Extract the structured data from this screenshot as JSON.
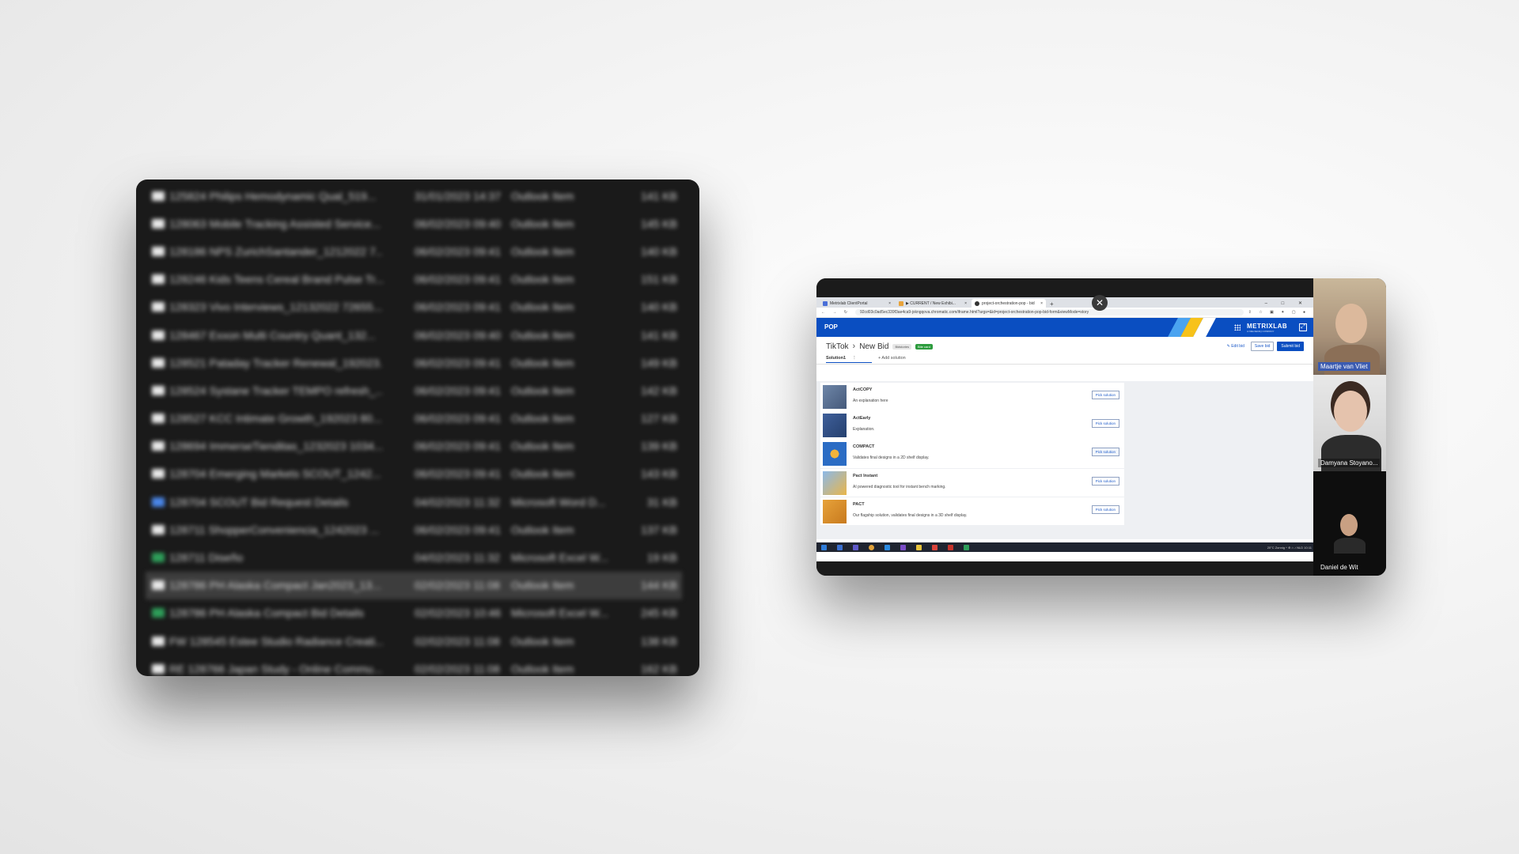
{
  "file_explorer": {
    "rows": [
      {
        "name": "125824 Philips Hemodynamic Qual_519...",
        "date": "31/01/2023 14:37",
        "type": "Outlook Item",
        "size": "141 KB",
        "icon": "mail-icon"
      },
      {
        "name": "128063 Mobile Tracking Assisted Service...",
        "date": "06/02/2023 09:40",
        "type": "Outlook Item",
        "size": "145 KB",
        "icon": "mail-icon"
      },
      {
        "name": "128186 NPS ZurichSantander_1212022 7...",
        "date": "06/02/2023 09:41",
        "type": "Outlook Item",
        "size": "140 KB",
        "icon": "mail-icon"
      },
      {
        "name": "128246 Kids Teens Cereal Brand Pulse Tr...",
        "date": "06/02/2023 09:41",
        "type": "Outlook Item",
        "size": "151 KB",
        "icon": "mail-icon"
      },
      {
        "name": "128323 Vivo Interviews_12132022 72655...",
        "date": "06/02/2023 09:41",
        "type": "Outlook Item",
        "size": "140 KB",
        "icon": "mail-icon"
      },
      {
        "name": "128467 Exxon Multi Country Quant_132...",
        "date": "06/02/2023 09:40",
        "type": "Outlook Item",
        "size": "141 KB",
        "icon": "mail-icon"
      },
      {
        "name": "128521 Pataday Tracker Renewal_192023...",
        "date": "06/02/2023 09:41",
        "type": "Outlook Item",
        "size": "149 KB",
        "icon": "mail-icon"
      },
      {
        "name": "128524 Systane Tracker TEMPO refresh_...",
        "date": "06/02/2023 09:41",
        "type": "Outlook Item",
        "size": "142 KB",
        "icon": "mail-icon"
      },
      {
        "name": "128527 KCC Intimate Growth_192023 80...",
        "date": "06/02/2023 09:41",
        "type": "Outlook Item",
        "size": "127 KB",
        "icon": "mail-icon"
      },
      {
        "name": "128694 ImmerseTienditas_1232023 1034...",
        "date": "06/02/2023 09:41",
        "type": "Outlook Item",
        "size": "139 KB",
        "icon": "mail-icon"
      },
      {
        "name": "128704 Emerging Markets SCOUT_1242...",
        "date": "06/02/2023 09:41",
        "type": "Outlook Item",
        "size": "143 KB",
        "icon": "mail-icon"
      },
      {
        "name": "128704 SCOUT Bid Request Details",
        "date": "04/02/2023 11:32",
        "type": "Microsoft Word D...",
        "size": "31 KB",
        "icon": "word-icon"
      },
      {
        "name": "128711 ShopperConveniencia_1242023 ...",
        "date": "06/02/2023 09:41",
        "type": "Outlook Item",
        "size": "137 KB",
        "icon": "mail-icon"
      },
      {
        "name": "128711 Diseño",
        "date": "04/02/2023 11:32",
        "type": "Microsoft Excel W...",
        "size": "19 KB",
        "icon": "excel-icon"
      },
      {
        "name": "128786 PH Alaska Compact Jan2023_13...",
        "date": "02/02/2023 11:08",
        "type": "Outlook Item",
        "size": "144 KB",
        "icon": "mail-icon",
        "selected": true
      },
      {
        "name": "128786 PH Alaska Compact Bid Details",
        "date": "02/02/2023 10:46",
        "type": "Microsoft Excel W...",
        "size": "245 KB",
        "icon": "excel-icon"
      },
      {
        "name": "FW 128545 Estee Studio Radiance Creati...",
        "date": "02/02/2023 11:08",
        "type": "Outlook Item",
        "size": "138 KB",
        "icon": "mail-icon"
      },
      {
        "name": "RE 128766 Japan Study - Online Commu...",
        "date": "02/02/2023 11:08",
        "type": "Outlook Item",
        "size": "162 KB",
        "icon": "mail-icon"
      }
    ]
  },
  "browser": {
    "tabs": [
      {
        "title": "Metrixlab ClientPortal",
        "active": false
      },
      {
        "title": "▶ CURRENT / New Exhibi... ",
        "active": false
      },
      {
        "title": "project-orchestration-pop - bid",
        "active": true
      }
    ],
    "url": "92cd03c0ad5ec339f3ae4ca9-jxkngqova.chromatic.com/iframe.html?args=&id=project-orchestration-pop-bid-form&viewMode=story"
  },
  "app": {
    "brand": "POP",
    "logo": "METRIXLAB",
    "logo_tagline": "A NIELSENIQ COMPANY",
    "breadcrumb_client": "TikTok",
    "breadcrumb_page": "New Bid",
    "status_badge": "Bidstories",
    "green_badge": "Bite card",
    "edit_bid": "Edit bid",
    "save_bid": "Save bid",
    "submit_bid": "Submit bid",
    "tab_solution": "Solution1",
    "tab_more": "⋮",
    "add_solution": "+ Add solution",
    "solutions": [
      {
        "name": "ActCOPY",
        "description": "An explanation here",
        "button": "Pick solution"
      },
      {
        "name": "ActEarly",
        "description": "Explanation.",
        "button": "Pick solution"
      },
      {
        "name": "COMPACT",
        "description": "Validates final designs in a 2D shelf display.",
        "button": "Pick solution"
      },
      {
        "name": "Pact Instant",
        "description": "AI powered diagnostic tool for instant bench marking.",
        "button": "Pick solution"
      },
      {
        "name": "PACT",
        "description": "Our flagship solution, validates final designs in a 3D shelf display.",
        "button": "Pick solution"
      }
    ]
  },
  "taskbar": {
    "tray": "20°C Zonnig   ^  ⊕  ⌂  ♪  NLD  10:11"
  },
  "participants": [
    {
      "name": "Maartje van Vliet"
    },
    {
      "name": "Damyana Stoyano..."
    },
    {
      "name": "Daniel de Wit"
    }
  ],
  "colors": {
    "app_header": "#0a4ec1",
    "excel": "#2e9e5a",
    "word": "#4a86e8",
    "badge_green": "#2d9c3e"
  }
}
